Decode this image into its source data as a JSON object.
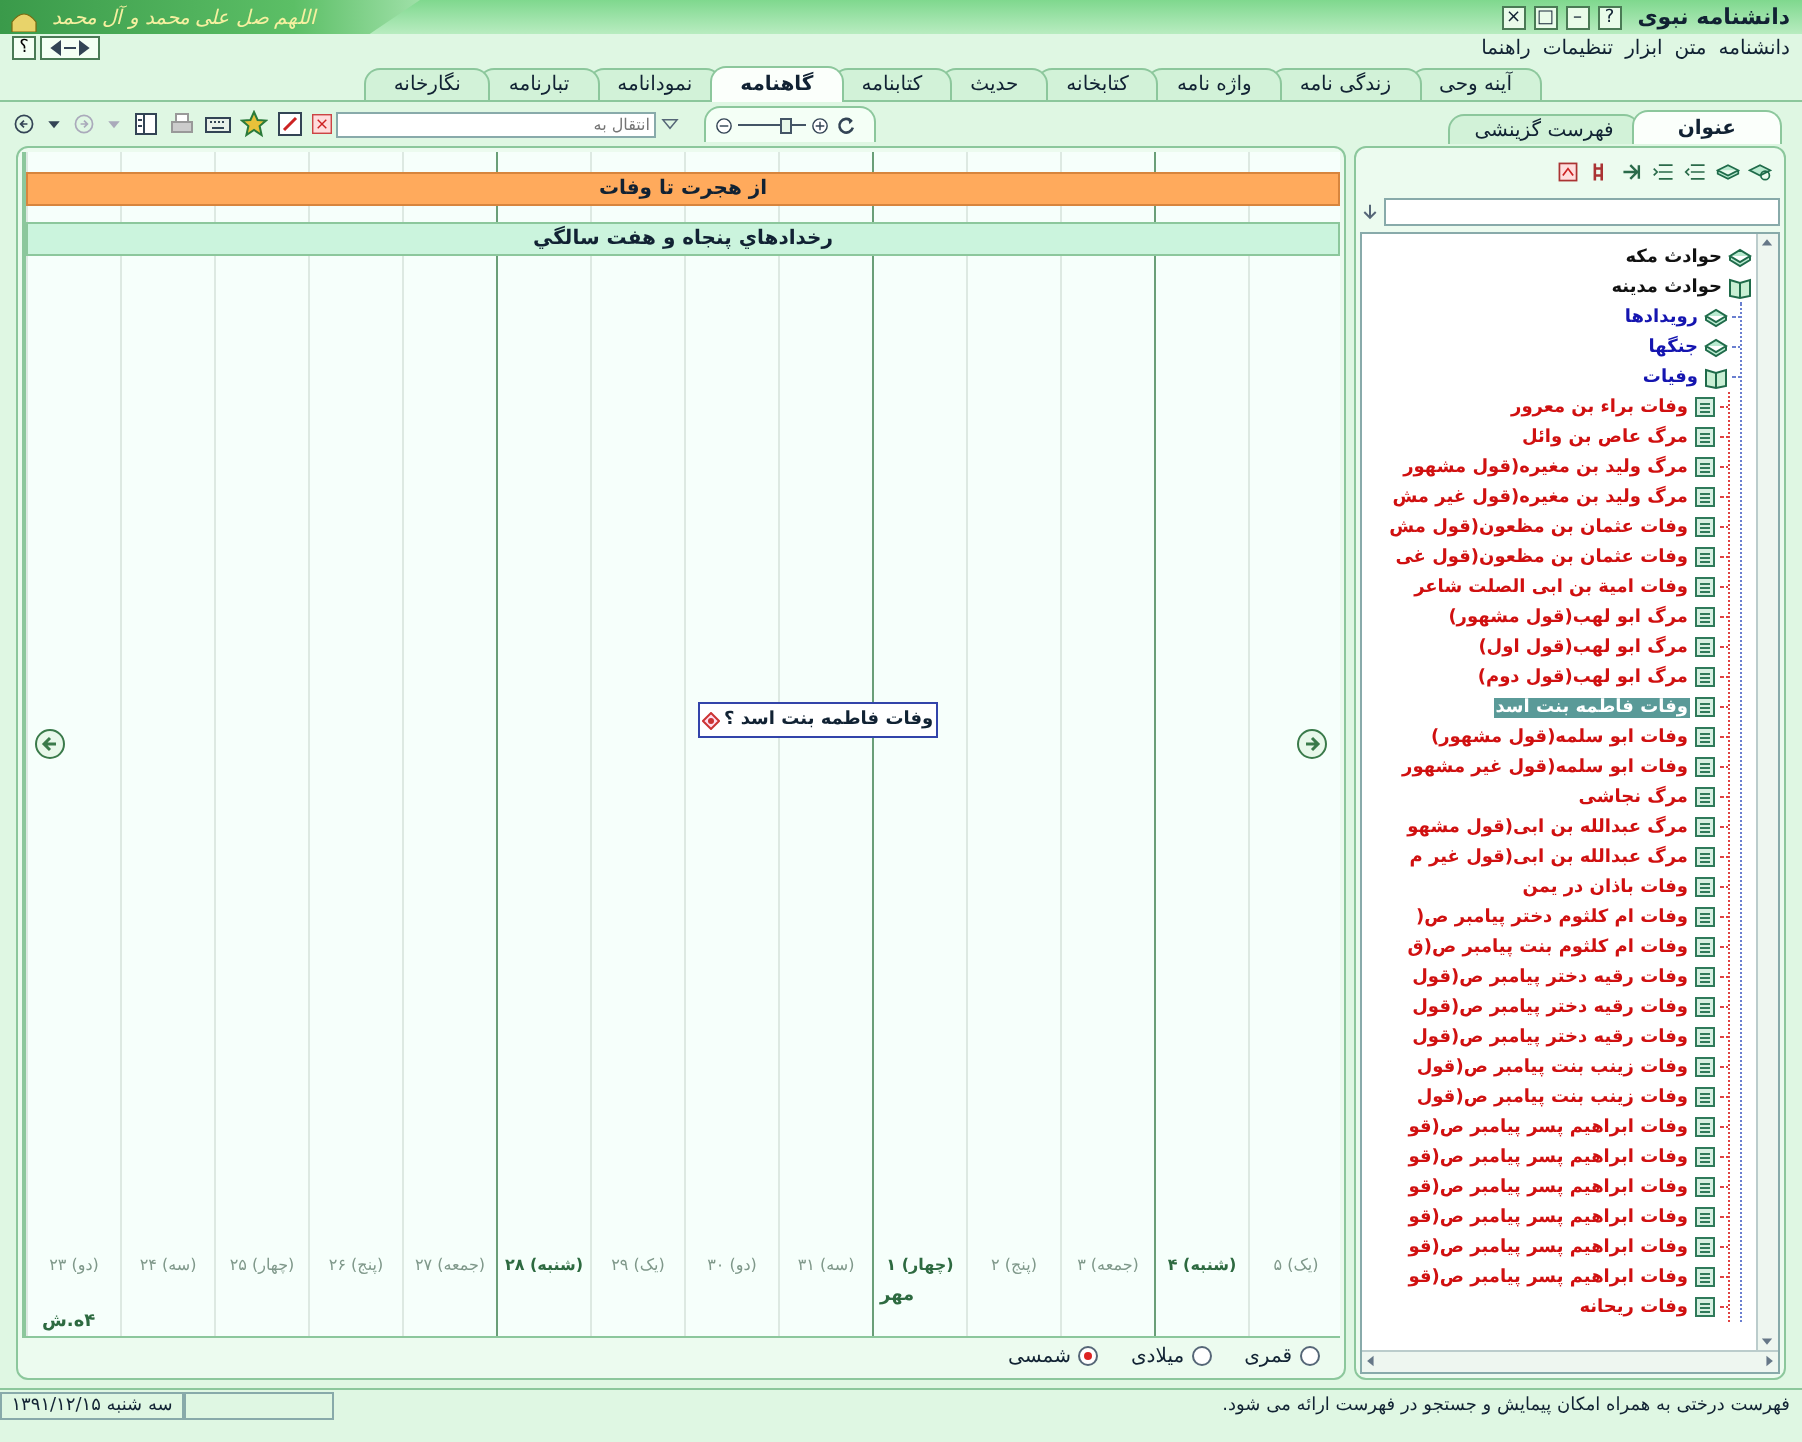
{
  "window": {
    "title": "دانشنامه نبوی",
    "banner": "اللهم صل علی محمد و آل محمد",
    "buttons": [
      "?",
      "–",
      "□",
      "×"
    ]
  },
  "menu": {
    "items": [
      "دانشنامه",
      "متن",
      "ابزار",
      "تنظیمات",
      "راهنما"
    ],
    "help": "؟"
  },
  "tabs": [
    {
      "label": "آینه وحی",
      "selected": false
    },
    {
      "label": "زندگی نامه",
      "selected": false
    },
    {
      "label": "واژه نامه",
      "selected": false
    },
    {
      "label": "کتابخانه",
      "selected": false
    },
    {
      "label": "حدیث",
      "selected": false
    },
    {
      "label": "کتابنامه",
      "selected": false
    },
    {
      "label": "گاهنامه",
      "selected": true
    },
    {
      "label": "نمودانامه",
      "selected": false
    },
    {
      "label": "تبارنامه",
      "selected": false
    },
    {
      "label": "نگارخانه",
      "selected": false
    }
  ],
  "toolbar": {
    "goto": {
      "placeholder": "انتقال به"
    },
    "zoom": {
      "level": 0.7
    }
  },
  "side_tabs": [
    {
      "label": "عنوان",
      "selected": true
    },
    {
      "label": "فهرست گزینشی",
      "selected": false
    }
  ],
  "timeline": {
    "bands": [
      {
        "label": "از هجرت تا وفات",
        "kind": "era"
      },
      {
        "label": "رخدادهاي پنجاه و هفت سالگي",
        "kind": "period"
      }
    ],
    "event": {
      "label": "وفات فاطمه بنت اسد ؟"
    },
    "ticks": [
      {
        "label": "(یک) ۵",
        "major": false
      },
      {
        "label": "(شنبه) ۴",
        "major": true
      },
      {
        "label": "(جمعه) ۳",
        "major": false
      },
      {
        "label": "(پنج) ۲",
        "major": false
      },
      {
        "label": "(چهار) ۱",
        "major": true,
        "month": "مهر"
      },
      {
        "label": "(سه) ۳۱",
        "major": false
      },
      {
        "label": "(دو) ۳۰",
        "major": false
      },
      {
        "label": "(یک) ۲۹",
        "major": false
      },
      {
        "label": "(شنبه) ۲۸",
        "major": true
      },
      {
        "label": "(جمعه) ۲۷",
        "major": false
      },
      {
        "label": "(پنج) ۲۶",
        "major": false
      },
      {
        "label": "(چهار) ۲۵",
        "major": false
      },
      {
        "label": "(سه) ۲۴",
        "major": false
      },
      {
        "label": "(دو) ۲۳",
        "major": false
      }
    ],
    "year": "۴ه.ش",
    "calendars": [
      {
        "label": "قمری",
        "selected": false
      },
      {
        "label": "میلادی",
        "selected": false
      },
      {
        "label": "شمسی",
        "selected": true
      }
    ]
  },
  "tree": {
    "items": [
      {
        "label": "حوادث مکه",
        "kind": "folder",
        "expanded": false,
        "selected": false
      },
      {
        "label": "حوادث مدینه",
        "kind": "folder",
        "expanded": true,
        "selected": false,
        "children": [
          {
            "label": "رویدادها",
            "kind": "folder",
            "expanded": false,
            "selected": false
          },
          {
            "label": "جنگها",
            "kind": "folder",
            "expanded": false,
            "selected": false
          },
          {
            "label": "وفیات",
            "kind": "folder",
            "expanded": true,
            "selected": false,
            "children": [
              {
                "label": "وفات براء بن معرور",
                "kind": "leaf",
                "selected": false
              },
              {
                "label": "مرگ عاص بن وائل",
                "kind": "leaf",
                "selected": false
              },
              {
                "label": "مرگ ولید بن مغیره(قول مشهور",
                "kind": "leaf",
                "selected": false
              },
              {
                "label": "مرگ ولید بن مغیره(قول غیر مش",
                "kind": "leaf",
                "selected": false
              },
              {
                "label": "وفات عثمان بن مظعون(قول مش",
                "kind": "leaf",
                "selected": false
              },
              {
                "label": "وفات عثمان بن مظعون(قول غی",
                "kind": "leaf",
                "selected": false
              },
              {
                "label": "وفات امیة بن ابی الصلت شاعر",
                "kind": "leaf",
                "selected": false
              },
              {
                "label": "مرگ ابو لهب(قول مشهور)",
                "kind": "leaf",
                "selected": false
              },
              {
                "label": "مرگ ابو لهب(قول اول)",
                "kind": "leaf",
                "selected": false
              },
              {
                "label": "مرگ ابو لهب(قول دوم)",
                "kind": "leaf",
                "selected": false
              },
              {
                "label": "وفات فاطمه بنت اسد",
                "kind": "leaf",
                "selected": true
              },
              {
                "label": "وفات ابو سلمه(قول مشهور)",
                "kind": "leaf",
                "selected": false
              },
              {
                "label": "وفات ابو سلمه(قول غیر مشهور",
                "kind": "leaf",
                "selected": false
              },
              {
                "label": "مرگ نجاشی",
                "kind": "leaf",
                "selected": false
              },
              {
                "label": "مرگ عبدالله بن ابی(قول مشهو",
                "kind": "leaf",
                "selected": false
              },
              {
                "label": "مرگ عبدالله بن ابی(قول غیر م",
                "kind": "leaf",
                "selected": false
              },
              {
                "label": "وفات باذان در یمن",
                "kind": "leaf",
                "selected": false
              },
              {
                "label": "وفات ام کلثوم دختر پیامبر ص(",
                "kind": "leaf",
                "selected": false
              },
              {
                "label": "وفات ام کلثوم بنت پیامبر ص(ق",
                "kind": "leaf",
                "selected": false
              },
              {
                "label": "وفات رقیه دختر پیامبر ص(قول",
                "kind": "leaf",
                "selected": false
              },
              {
                "label": "وفات رقیه دختر پیامبر ص(قول",
                "kind": "leaf",
                "selected": false
              },
              {
                "label": "وفات رقیه دختر پیامبر ص(قول",
                "kind": "leaf",
                "selected": false
              },
              {
                "label": "وفات زینب بنت پیامبر ص(قول",
                "kind": "leaf",
                "selected": false
              },
              {
                "label": "وفات زینب بنت پیامبر ص(قول",
                "kind": "leaf",
                "selected": false
              },
              {
                "label": "وفات ابراهیم پسر پیامبر ص(قو",
                "kind": "leaf",
                "selected": false
              },
              {
                "label": "وفات ابراهیم پسر پیامبر ص(قو",
                "kind": "leaf",
                "selected": false
              },
              {
                "label": "وفات ابراهیم پسر پیامبر ص(قو",
                "kind": "leaf",
                "selected": false
              },
              {
                "label": "وفات ابراهیم پسر پیامبر ص(قو",
                "kind": "leaf",
                "selected": false
              },
              {
                "label": "وفات ابراهیم پسر پیامبر ص(قو",
                "kind": "leaf",
                "selected": false
              },
              {
                "label": "وفات ابراهیم پسر پیامبر ص(قو",
                "kind": "leaf",
                "selected": false
              },
              {
                "label": "وفات ریحانه",
                "kind": "leaf",
                "selected": false
              }
            ]
          }
        ]
      }
    ]
  },
  "status_bar": {
    "message": "فهرست درختی به همراه امکان پیمایش و جستجو در فهرست ارائه می شود.",
    "date": "سه شنبه ۱۳۹۱/۱۲/۱۵"
  }
}
